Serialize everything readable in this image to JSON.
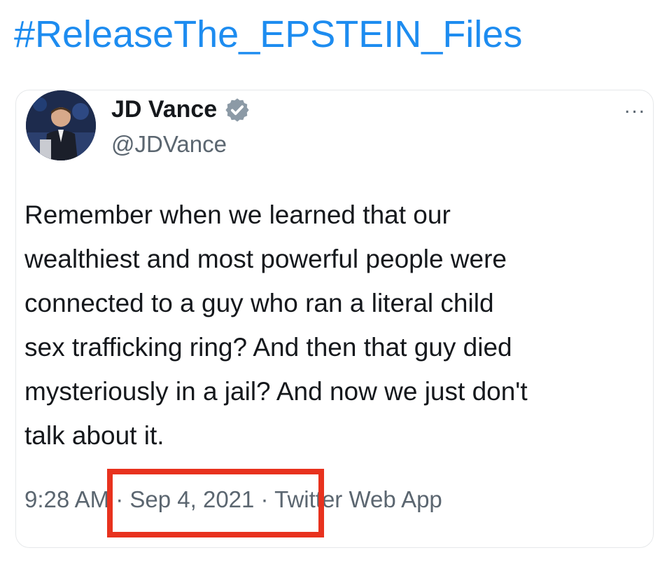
{
  "hashtag": "#ReleaseThe_EPSTEIN_Files",
  "tweet": {
    "author_name": "JD Vance",
    "author_handle": "@JDVance",
    "more_icon": "...",
    "text": "Remember when we learned that our\nwealthiest and most powerful people were\nconnected to a guy who ran a literal child\nsex trafficking ring? And then that guy died\nmysteriously in a jail? And now we just don't\ntalk about it.",
    "meta": "9:28 AM · Sep 4, 2021 · Twitter Web App"
  },
  "colors": {
    "hashtag": "#1d8cf0",
    "highlight_box": "#e8321e",
    "secondary_text": "#5b6670",
    "verified_badge": "#8c9aa6"
  },
  "icons": {
    "avatar": "avatar-photo",
    "verified": "verified-badge-icon",
    "more": "more-options-icon"
  }
}
